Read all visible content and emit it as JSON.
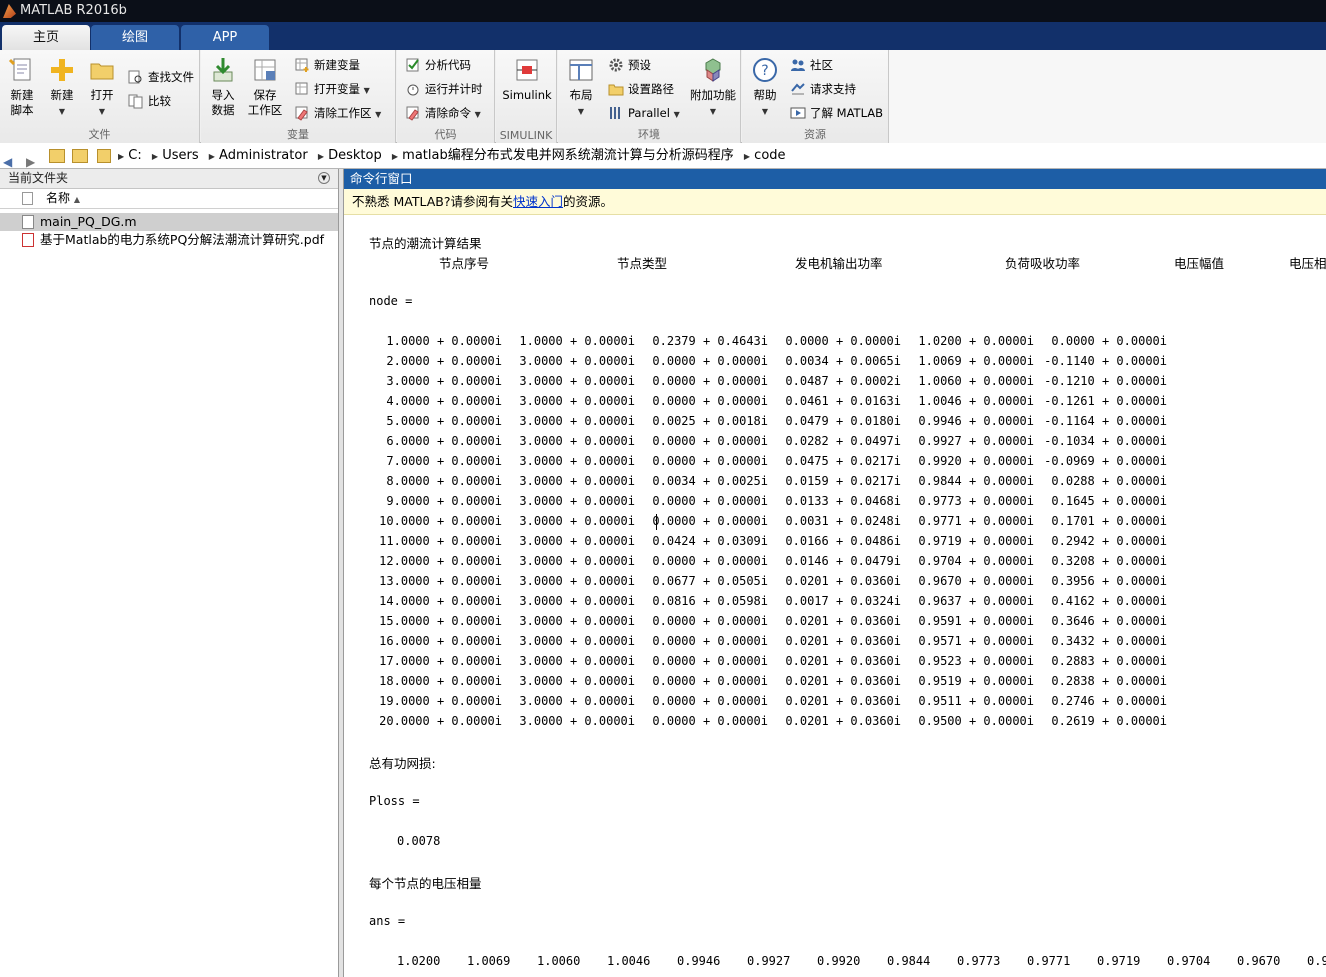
{
  "window": {
    "title": "MATLAB R2016b"
  },
  "tabs": [
    "主页",
    "绘图",
    "APP"
  ],
  "ribbon": {
    "file": {
      "label": "文件",
      "new_script": [
        "新建",
        "脚本"
      ],
      "new": "新建",
      "open": "打开",
      "find_files": "查找文件",
      "compare": "比较"
    },
    "variable": {
      "label": "变量",
      "import": [
        "导入",
        "数据"
      ],
      "save_ws": [
        "保存",
        "工作区"
      ],
      "new_var": "新建变量",
      "open_var": "打开变量",
      "clear_ws": "清除工作区"
    },
    "code": {
      "label": "代码",
      "analyze": "分析代码",
      "run_time": "运行并计时",
      "clear_cmd": "清除命令"
    },
    "simulink": {
      "label": "SIMULINK",
      "simulink": "Simulink"
    },
    "env": {
      "label": "环境",
      "layout": "布局",
      "prefs": "预设",
      "set_path": "设置路径",
      "parallel": "Parallel",
      "addons": "附加功能"
    },
    "resources": {
      "label": "资源",
      "help": "帮助",
      "community": "社区",
      "support": "请求支持",
      "learn": "了解 MATLAB"
    }
  },
  "address": {
    "path": [
      "C:",
      "Users",
      "Administrator",
      "Desktop",
      "matlab编程分布式发电并网系统潮流计算与分析源码程序",
      "code"
    ]
  },
  "current_folder": {
    "title": "当前文件夹",
    "name_col": "名称",
    "files": [
      "main_PQ_DG.m",
      "基于Matlab的电力系统PQ分解法潮流计算研究.pdf"
    ]
  },
  "command_window": {
    "title": "命令行窗口",
    "notice_pre": "不熟悉 MATLAB?请参阅有关",
    "notice_link": "快速入门",
    "notice_post": "的资源。",
    "result_title": "节点的潮流计算结果",
    "headers": [
      "节点序号",
      "节点类型",
      "发电机输出功率",
      "负荷吸收功率",
      "电压幅值",
      "电压相"
    ],
    "node_var": "node =",
    "rows": [
      [
        "1.0000 + 0.0000i",
        "1.0000 + 0.0000i",
        "0.2379 + 0.4643i",
        "0.0000 + 0.0000i",
        "1.0200 + 0.0000i",
        " 0.0000 + 0.0000i"
      ],
      [
        "2.0000 + 0.0000i",
        "3.0000 + 0.0000i",
        "0.0000 + 0.0000i",
        "0.0034 + 0.0065i",
        "1.0069 + 0.0000i",
        "-0.1140 + 0.0000i"
      ],
      [
        "3.0000 + 0.0000i",
        "3.0000 + 0.0000i",
        "0.0000 + 0.0000i",
        "0.0487 + 0.0002i",
        "1.0060 + 0.0000i",
        "-0.1210 + 0.0000i"
      ],
      [
        "4.0000 + 0.0000i",
        "3.0000 + 0.0000i",
        "0.0000 + 0.0000i",
        "0.0461 + 0.0163i",
        "1.0046 + 0.0000i",
        "-0.1261 + 0.0000i"
      ],
      [
        "5.0000 + 0.0000i",
        "3.0000 + 0.0000i",
        "0.0025 + 0.0018i",
        "0.0479 + 0.0180i",
        "0.9946 + 0.0000i",
        "-0.1164 + 0.0000i"
      ],
      [
        "6.0000 + 0.0000i",
        "3.0000 + 0.0000i",
        "0.0000 + 0.0000i",
        "0.0282 + 0.0497i",
        "0.9927 + 0.0000i",
        "-0.1034 + 0.0000i"
      ],
      [
        "7.0000 + 0.0000i",
        "3.0000 + 0.0000i",
        "0.0000 + 0.0000i",
        "0.0475 + 0.0217i",
        "0.9920 + 0.0000i",
        "-0.0969 + 0.0000i"
      ],
      [
        "8.0000 + 0.0000i",
        "3.0000 + 0.0000i",
        "0.0034 + 0.0025i",
        "0.0159 + 0.0217i",
        "0.9844 + 0.0000i",
        " 0.0288 + 0.0000i"
      ],
      [
        "9.0000 + 0.0000i",
        "3.0000 + 0.0000i",
        "0.0000 + 0.0000i",
        "0.0133 + 0.0468i",
        "0.9773 + 0.0000i",
        " 0.1645 + 0.0000i"
      ],
      [
        "10.0000 + 0.0000i",
        "3.0000 + 0.0000i",
        "0.0000 + 0.0000i",
        "0.0031 + 0.0248i",
        "0.9771 + 0.0000i",
        " 0.1701 + 0.0000i"
      ],
      [
        "11.0000 + 0.0000i",
        "3.0000 + 0.0000i",
        "0.0424 + 0.0309i",
        "0.0166 + 0.0486i",
        "0.9719 + 0.0000i",
        " 0.2942 + 0.0000i"
      ],
      [
        "12.0000 + 0.0000i",
        "3.0000 + 0.0000i",
        "0.0000 + 0.0000i",
        "0.0146 + 0.0479i",
        "0.9704 + 0.0000i",
        " 0.3208 + 0.0000i"
      ],
      [
        "13.0000 + 0.0000i",
        "3.0000 + 0.0000i",
        "0.0677 + 0.0505i",
        "0.0201 + 0.0360i",
        "0.9670 + 0.0000i",
        " 0.3956 + 0.0000i"
      ],
      [
        "14.0000 + 0.0000i",
        "3.0000 + 0.0000i",
        "0.0816 + 0.0598i",
        "0.0017 + 0.0324i",
        "0.9637 + 0.0000i",
        " 0.4162 + 0.0000i"
      ],
      [
        "15.0000 + 0.0000i",
        "3.0000 + 0.0000i",
        "0.0000 + 0.0000i",
        "0.0201 + 0.0360i",
        "0.9591 + 0.0000i",
        " 0.3646 + 0.0000i"
      ],
      [
        "16.0000 + 0.0000i",
        "3.0000 + 0.0000i",
        "0.0000 + 0.0000i",
        "0.0201 + 0.0360i",
        "0.9571 + 0.0000i",
        " 0.3432 + 0.0000i"
      ],
      [
        "17.0000 + 0.0000i",
        "3.0000 + 0.0000i",
        "0.0000 + 0.0000i",
        "0.0201 + 0.0360i",
        "0.9523 + 0.0000i",
        " 0.2883 + 0.0000i"
      ],
      [
        "18.0000 + 0.0000i",
        "3.0000 + 0.0000i",
        "0.0000 + 0.0000i",
        "0.0201 + 0.0360i",
        "0.9519 + 0.0000i",
        " 0.2838 + 0.0000i"
      ],
      [
        "19.0000 + 0.0000i",
        "3.0000 + 0.0000i",
        "0.0000 + 0.0000i",
        "0.0201 + 0.0360i",
        "0.9511 + 0.0000i",
        " 0.2746 + 0.0000i"
      ],
      [
        "20.0000 + 0.0000i",
        "3.0000 + 0.0000i",
        "0.0000 + 0.0000i",
        "0.0201 + 0.0360i",
        "0.9500 + 0.0000i",
        " 0.2619 + 0.0000i"
      ]
    ],
    "loss_title": "总有功网损:",
    "ploss_var": "Ploss =",
    "ploss_value": "0.0078",
    "volt_title": "每个节点的电压相量",
    "ans_var": "ans =",
    "ans_values": [
      "1.0200",
      "1.0069",
      "1.0060",
      "1.0046",
      "0.9946",
      "0.9927",
      "0.9920",
      "0.9844",
      "0.9773",
      "0.9771",
      "0.9719",
      "0.9704",
      "0.9670",
      "0.9"
    ]
  }
}
